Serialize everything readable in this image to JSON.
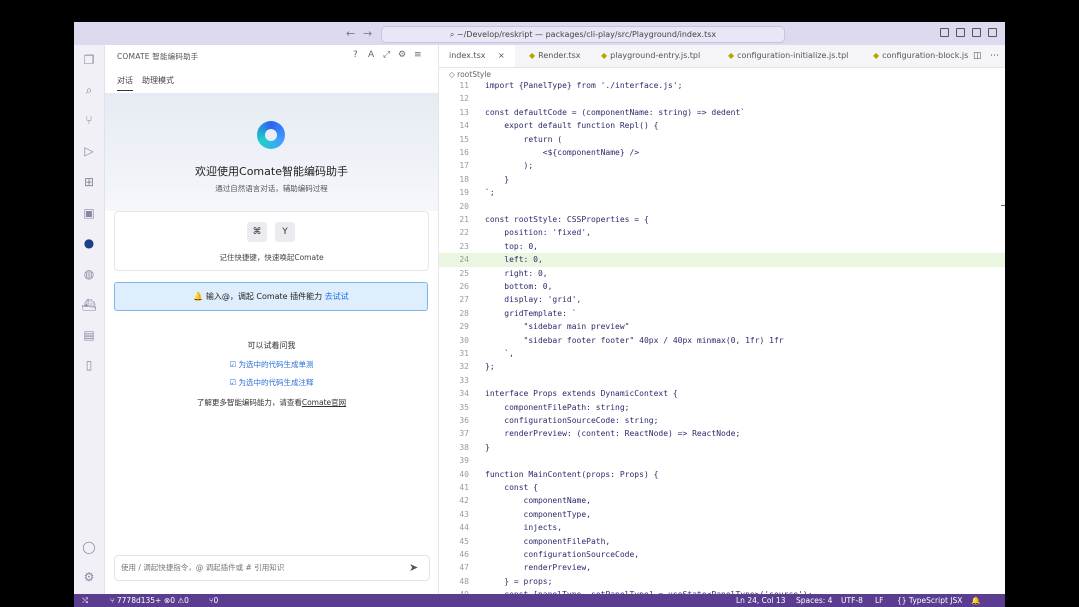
{
  "titlebar": {
    "command_text": "~/Develop/reskript — packages/cli-play/src/Playground/index.tsx"
  },
  "chat": {
    "title": "COMATE 智能编码助手",
    "tabs": [
      "对话",
      "助理模式"
    ],
    "hero_title": "欢迎使用Comate智能编码助手",
    "hero_subtitle": "通过自然语言对话，辅助编码过程",
    "keys": [
      "⌘",
      "Y"
    ],
    "shortcut_text": "记住快捷键，快速唤起Comate",
    "plugin_tip": "🔔 输入@，调起 Comate 插件能力",
    "plugin_try": "去试试",
    "suggest_title": "可以试着问我",
    "suggestions": [
      "☑ 为选中的代码生成单测",
      "☑ 为选中的代码生成注释"
    ],
    "more_info_prefix": "了解更多智能编码能力，请查看",
    "more_info_link": "Comate官网",
    "input_placeholder": "使用 / 调起快捷指令，@ 调起插件或 # 引用知识"
  },
  "editor": {
    "tabs": [
      {
        "label": "index.tsx",
        "close": "×"
      },
      {
        "label": "Render.tsx"
      },
      {
        "label": "playground-entry.js.tpl"
      },
      {
        "label": "configuration-initialize.js.tpl"
      },
      {
        "label": "configuration-block.js"
      }
    ],
    "breadcrumb": "rootStyle",
    "lines": [
      {
        "n": "11",
        "t": "import {PanelType} from './interface.js';"
      },
      {
        "n": "12",
        "t": ""
      },
      {
        "n": "13",
        "t": "const defaultCode = (componentName: string) => dedent`"
      },
      {
        "n": "14",
        "t": "    export default function Repl() {"
      },
      {
        "n": "15",
        "t": "        return ("
      },
      {
        "n": "16",
        "t": "            <${componentName} />"
      },
      {
        "n": "17",
        "t": "        );"
      },
      {
        "n": "18",
        "t": "    }"
      },
      {
        "n": "19",
        "t": "`;"
      },
      {
        "n": "20",
        "t": ""
      },
      {
        "n": "21",
        "t": "const rootStyle: CSSProperties = {"
      },
      {
        "n": "22",
        "t": "    position: 'fixed',"
      },
      {
        "n": "23",
        "t": "    top: 0,"
      },
      {
        "n": "24",
        "t": "    left: 0,"
      },
      {
        "n": "25",
        "t": "    right: 0,"
      },
      {
        "n": "26",
        "t": "    bottom: 0,"
      },
      {
        "n": "27",
        "t": "    display: 'grid',"
      },
      {
        "n": "28",
        "t": "    gridTemplate: `"
      },
      {
        "n": "29",
        "t": "        \"sidebar main preview\""
      },
      {
        "n": "30",
        "t": "        \"sidebar footer footer\" 40px / 40px minmax(0, 1fr) 1fr"
      },
      {
        "n": "31",
        "t": "    `,"
      },
      {
        "n": "32",
        "t": "};"
      },
      {
        "n": "33",
        "t": ""
      },
      {
        "n": "34",
        "t": "interface Props extends DynamicContext {"
      },
      {
        "n": "35",
        "t": "    componentFilePath: string;"
      },
      {
        "n": "36",
        "t": "    configurationSourceCode: string;"
      },
      {
        "n": "37",
        "t": "    renderPreview: (content: ReactNode) => ReactNode;"
      },
      {
        "n": "38",
        "t": "}"
      },
      {
        "n": "39",
        "t": ""
      },
      {
        "n": "40",
        "t": "function MainContent(props: Props) {"
      },
      {
        "n": "41",
        "t": "    const {"
      },
      {
        "n": "42",
        "t": "        componentName,"
      },
      {
        "n": "43",
        "t": "        componentType,"
      },
      {
        "n": "44",
        "t": "        injects,"
      },
      {
        "n": "45",
        "t": "        componentFilePath,"
      },
      {
        "n": "46",
        "t": "        configurationSourceCode,"
      },
      {
        "n": "47",
        "t": "        renderPreview,"
      },
      {
        "n": "48",
        "t": "    } = props;"
      },
      {
        "n": "49",
        "t": "    const [panelType, setPanelType] = useState<PanelType>('source');"
      }
    ],
    "highlight_line": "24"
  },
  "status": {
    "branch": "7778d135+",
    "problems": "⊗0 ⚠0",
    "ports": "⑂0",
    "position": "Ln 24, Col 13",
    "spaces": "Spaces: 4",
    "encoding": "UTF-8",
    "eol": "LF",
    "language": "{} TypeScript JSX"
  }
}
